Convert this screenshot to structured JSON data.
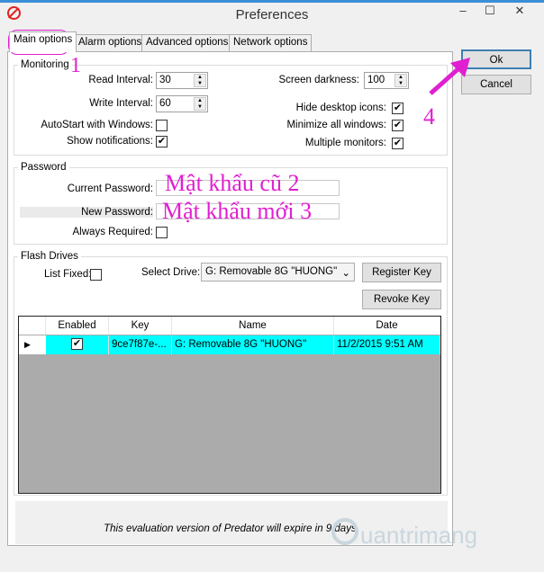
{
  "window": {
    "title": "Preferences",
    "minimize": "–",
    "maximize": "☐",
    "close": "✕"
  },
  "tabs": [
    "Main options",
    "Alarm options",
    "Advanced options",
    "Network options"
  ],
  "monitoring": {
    "legend": "Monitoring",
    "read_label": "Read Interval:",
    "read_value": "30",
    "write_label": "Write Interval:",
    "write_value": "60",
    "autostart_label": "AutoStart with Windows:",
    "autostart": false,
    "notify_label": "Show notifications:",
    "notify": true,
    "darkness_label": "Screen darkness:",
    "darkness_value": "100",
    "hide_icons_label": "Hide desktop icons:",
    "hide_icons": true,
    "minimize_label": "Minimize all windows:",
    "minimize": true,
    "multi_label": "Multiple monitors:",
    "multi": true
  },
  "password": {
    "legend": "Password",
    "current_label": "Current Password:",
    "new_label": "New Password:",
    "always_label": "Always Required:",
    "always": false
  },
  "flash": {
    "legend": "Flash Drives",
    "list_fixed_label": "List Fixed:",
    "select_label": "Select Drive:",
    "selected_drive": "G: Removable 8G \"HUONG\"",
    "register": "Register Key",
    "revoke": "Revoke Key",
    "columns": [
      "Enabled",
      "Key",
      "Name",
      "Date"
    ],
    "rows": [
      {
        "enabled": true,
        "key": "9ce7f87e-...",
        "name": "G: Removable 8G \"HUONG\"",
        "date": "11/2/2015 9:51 AM"
      }
    ]
  },
  "footer": "This evaluation version of Predator will expire in 9 days.",
  "buttons": {
    "ok": "Ok",
    "cancel": "Cancel"
  },
  "annotations": {
    "a1": "1",
    "a2": "Mật khẩu cũ  2",
    "a3": "Mật khẩu mới 3",
    "a4": "4"
  },
  "watermark": "uantrimang",
  "check": "✔"
}
